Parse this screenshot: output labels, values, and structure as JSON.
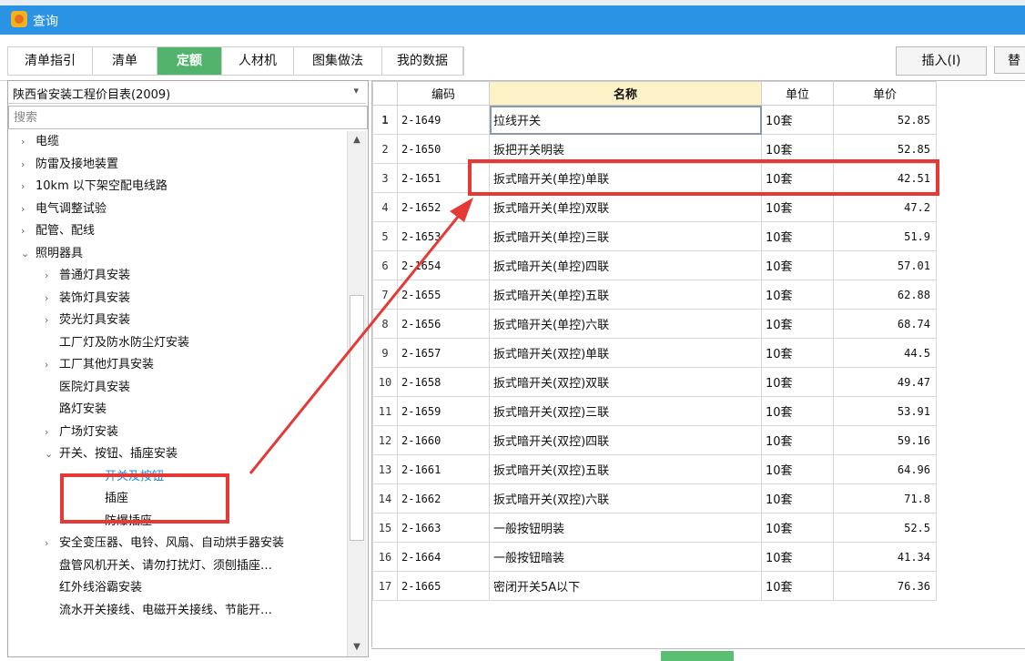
{
  "window": {
    "title": "查询",
    "icon": "app-logo-icon"
  },
  "tabs": [
    {
      "label": "清单指引",
      "active": false
    },
    {
      "label": "清单",
      "active": false
    },
    {
      "label": "定额",
      "active": true
    },
    {
      "label": "人材机",
      "active": false
    },
    {
      "label": "图集做法",
      "active": false
    },
    {
      "label": "我的数据",
      "active": false
    }
  ],
  "toolbar": {
    "insert_label": "插入(I)",
    "next_label": "替"
  },
  "left": {
    "catalog_value": "陕西省安装工程价目表(2009)",
    "search_placeholder": "搜索",
    "tree": [
      {
        "label": "电缆",
        "level": 1,
        "expander": "›"
      },
      {
        "label": "防雷及接地装置",
        "level": 1,
        "expander": "›"
      },
      {
        "label": "10km 以下架空配电线路",
        "level": 1,
        "expander": "›"
      },
      {
        "label": "电气调整试验",
        "level": 1,
        "expander": "›"
      },
      {
        "label": "配管、配线",
        "level": 1,
        "expander": "›"
      },
      {
        "label": "照明器具",
        "level": 1,
        "expander": "⌄"
      },
      {
        "label": "普通灯具安装",
        "level": 2,
        "expander": "›"
      },
      {
        "label": "装饰灯具安装",
        "level": 2,
        "expander": "›"
      },
      {
        "label": "荧光灯具安装",
        "level": 2,
        "expander": "›"
      },
      {
        "label": "工厂灯及防水防尘灯安装",
        "level": 2,
        "expander": ""
      },
      {
        "label": "工厂其他灯具安装",
        "level": 2,
        "expander": "›"
      },
      {
        "label": "医院灯具安装",
        "level": 2,
        "expander": ""
      },
      {
        "label": "路灯安装",
        "level": 2,
        "expander": ""
      },
      {
        "label": "广场灯安装",
        "level": 2,
        "expander": "›"
      },
      {
        "label": "开关、按钮、插座安装",
        "level": 2,
        "expander": "⌄"
      },
      {
        "label": "开关及按钮",
        "level": 3,
        "expander": "",
        "selected": true
      },
      {
        "label": "插座",
        "level": 3,
        "expander": ""
      },
      {
        "label": "防爆插座",
        "level": 3,
        "expander": ""
      },
      {
        "label": "安全变压器、电铃、风扇、自动烘手器安装",
        "level": 2,
        "expander": "›"
      },
      {
        "label": "盘管风机开关、请勿打扰灯、须刨插座…",
        "level": 2,
        "expander": ""
      },
      {
        "label": "红外线浴霸安装",
        "level": 2,
        "expander": ""
      },
      {
        "label": "流水开关接线、电磁开关接线、节能开…",
        "level": 2,
        "expander": ""
      }
    ]
  },
  "grid": {
    "headers": {
      "code": "编码",
      "name": "名称",
      "unit": "单位",
      "price": "单价"
    },
    "rows": [
      {
        "n": "1",
        "code": "2-1649",
        "name": "拉线开关",
        "unit": "10套",
        "price": "52.85"
      },
      {
        "n": "2",
        "code": "2-1650",
        "name": "扳把开关明装",
        "unit": "10套",
        "price": "52.85"
      },
      {
        "n": "3",
        "code": "2-1651",
        "name": "扳式暗开关(单控)单联",
        "unit": "10套",
        "price": "42.51"
      },
      {
        "n": "4",
        "code": "2-1652",
        "name": "扳式暗开关(单控)双联",
        "unit": "10套",
        "price": "47.2"
      },
      {
        "n": "5",
        "code": "2-1653",
        "name": "扳式暗开关(单控)三联",
        "unit": "10套",
        "price": "51.9"
      },
      {
        "n": "6",
        "code": "2-1654",
        "name": "扳式暗开关(单控)四联",
        "unit": "10套",
        "price": "57.01"
      },
      {
        "n": "7",
        "code": "2-1655",
        "name": "扳式暗开关(单控)五联",
        "unit": "10套",
        "price": "62.88"
      },
      {
        "n": "8",
        "code": "2-1656",
        "name": "扳式暗开关(单控)六联",
        "unit": "10套",
        "price": "68.74"
      },
      {
        "n": "9",
        "code": "2-1657",
        "name": "扳式暗开关(双控)单联",
        "unit": "10套",
        "price": "44.5"
      },
      {
        "n": "10",
        "code": "2-1658",
        "name": "扳式暗开关(双控)双联",
        "unit": "10套",
        "price": "49.47"
      },
      {
        "n": "11",
        "code": "2-1659",
        "name": "扳式暗开关(双控)三联",
        "unit": "10套",
        "price": "53.91"
      },
      {
        "n": "12",
        "code": "2-1660",
        "name": "扳式暗开关(双控)四联",
        "unit": "10套",
        "price": "59.16"
      },
      {
        "n": "13",
        "code": "2-1661",
        "name": "扳式暗开关(双控)五联",
        "unit": "10套",
        "price": "64.96"
      },
      {
        "n": "14",
        "code": "2-1662",
        "name": "扳式暗开关(双控)六联",
        "unit": "10套",
        "price": "71.8"
      },
      {
        "n": "15",
        "code": "2-1663",
        "name": "一般按钮明装",
        "unit": "10套",
        "price": "52.5"
      },
      {
        "n": "16",
        "code": "2-1664",
        "name": "一般按钮暗装",
        "unit": "10套",
        "price": "41.34"
      },
      {
        "n": "17",
        "code": "2-1665",
        "name": "密闭开关5A以下",
        "unit": "10套",
        "price": "76.36"
      }
    ]
  },
  "annotations": {
    "highlight_color": "#e53935"
  }
}
